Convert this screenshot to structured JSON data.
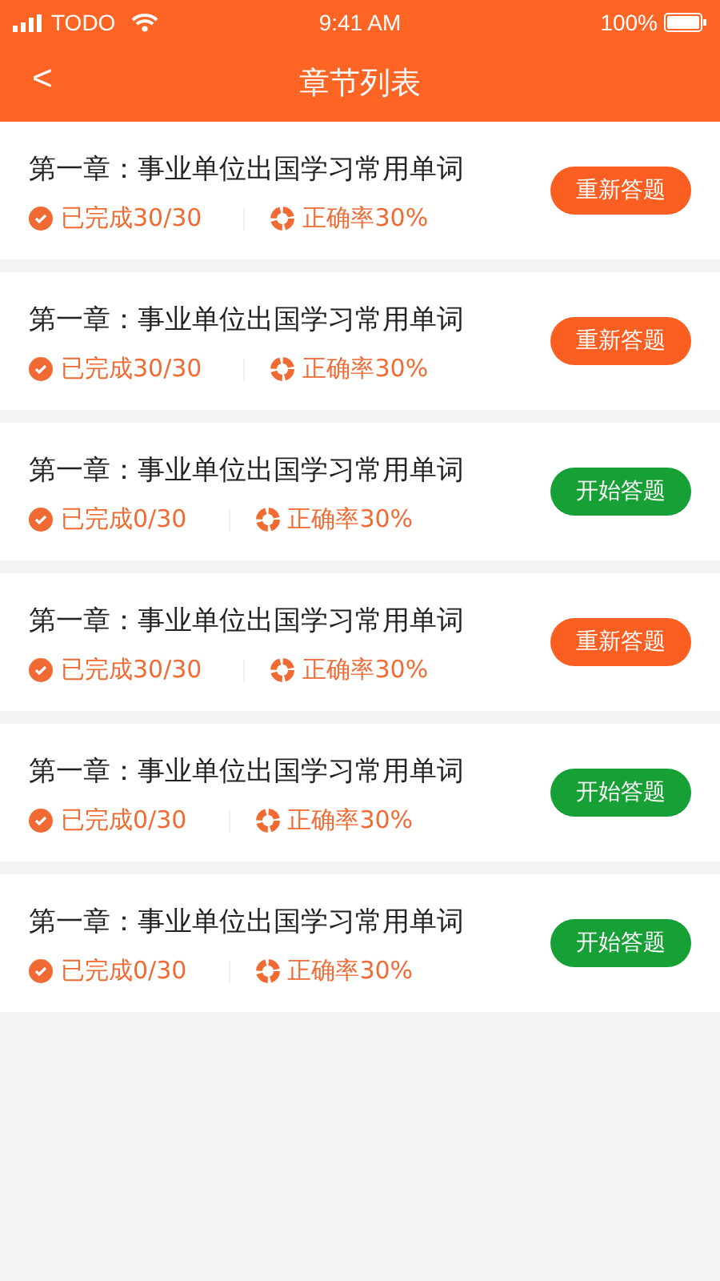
{
  "status_bar": {
    "carrier": "TODO",
    "time": "9:41 AM",
    "battery": "100%"
  },
  "nav": {
    "back": "<",
    "title": "章节列表"
  },
  "chapters": [
    {
      "title": "第一章：事业单位出国学习常用单词",
      "completed": "已完成30/30",
      "accuracy": "正确率30%",
      "button": {
        "kind": "redo",
        "label": "重新答题"
      }
    },
    {
      "title": "第一章：事业单位出国学习常用单词",
      "completed": "已完成30/30",
      "accuracy": "正确率30%",
      "button": {
        "kind": "redo",
        "label": "重新答题"
      }
    },
    {
      "title": "第一章：事业单位出国学习常用单词",
      "completed": "已完成0/30",
      "accuracy": "正确率30%",
      "button": {
        "kind": "start",
        "label": "开始答题"
      }
    },
    {
      "title": "第一章：事业单位出国学习常用单词",
      "completed": "已完成30/30",
      "accuracy": "正确率30%",
      "button": {
        "kind": "redo",
        "label": "重新答题"
      }
    },
    {
      "title": "第一章：事业单位出国学习常用单词",
      "completed": "已完成0/30",
      "accuracy": "正确率30%",
      "button": {
        "kind": "start",
        "label": "开始答题"
      }
    },
    {
      "title": "第一章：事业单位出国学习常用单词",
      "completed": "已完成0/30",
      "accuracy": "正确率30%",
      "button": {
        "kind": "start",
        "label": "开始答题"
      }
    }
  ]
}
